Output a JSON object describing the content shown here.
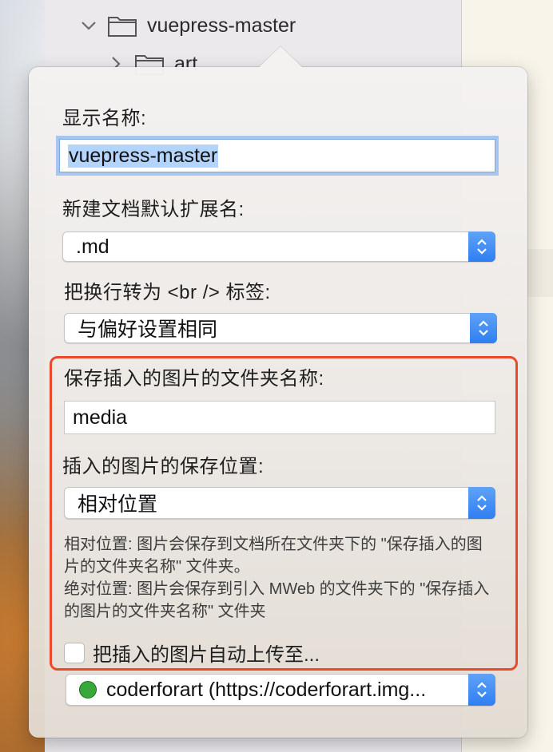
{
  "finder": {
    "tree": [
      {
        "label": "vuepress-master",
        "expanded": true
      },
      {
        "label": "art",
        "expanded": false
      }
    ]
  },
  "popover": {
    "display_name": {
      "label": "显示名称:",
      "value": "vuepress-master"
    },
    "default_extension": {
      "label": "新建文档默认扩展名:",
      "value": ".md"
    },
    "line_break": {
      "label": "把换行转为 <br /> 标签:",
      "value": "与偏好设置相同"
    },
    "image_folder_name": {
      "label": "保存插入的图片的文件夹名称:",
      "value": "media"
    },
    "image_location": {
      "label": "插入的图片的保存位置:",
      "value": "相对位置"
    },
    "help": {
      "line1": "相对位置: 图片会保存到文档所在文件夹下的 \"保存插入的图片的文件夹名称\" 文件夹。",
      "line2": "绝对位置: 图片会保存到引入 MWeb 的文件夹下的 \"保存插入的图片的文件夹名称\" 文件夹"
    },
    "auto_upload": {
      "label": "把插入的图片自动上传至...",
      "checked": false
    },
    "upload_service": {
      "value": "coderforart (https://coderforart.img...",
      "status_color": "#39a83a"
    }
  },
  "colors": {
    "highlight": "#ea4a2c",
    "accent": "#2f7ff2",
    "focus_ring": "#a7c5ee"
  }
}
